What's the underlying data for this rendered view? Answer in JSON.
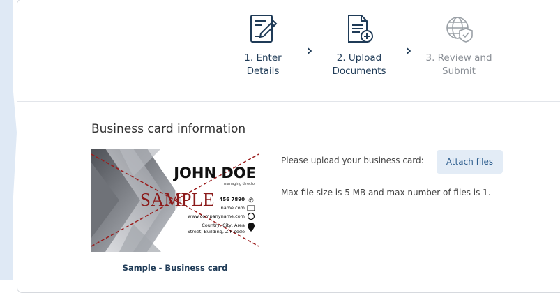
{
  "steps": [
    {
      "label": "1. Enter\nDetails",
      "state": "done",
      "icon": "edit-document-icon"
    },
    {
      "label": "2. Upload\nDocuments",
      "state": "current",
      "icon": "document-add-icon"
    },
    {
      "label": "3. Review and\nSubmit",
      "state": "upcoming",
      "icon": "globe-shield-icon"
    }
  ],
  "section": {
    "title": "Business card information"
  },
  "sample_card": {
    "name": "JOHN DOE",
    "role": "managing director",
    "phone": "456 7890",
    "email": "name.com",
    "website": "www.companyname.com",
    "address_line1": "Country, City, Area",
    "address_line2": "Street, Building, ZIP code",
    "watermark": "SAMPLE",
    "caption": "Sample - Business card"
  },
  "upload": {
    "prompt": "Please upload your business card:",
    "button_label": "Attach files",
    "limits_text": "Max file size is 5 MB and max number of files is 1."
  },
  "colors": {
    "accent_dark": "#1f3b57",
    "button_bg": "#e3ecf6",
    "watermark": "#8b1a1a"
  }
}
